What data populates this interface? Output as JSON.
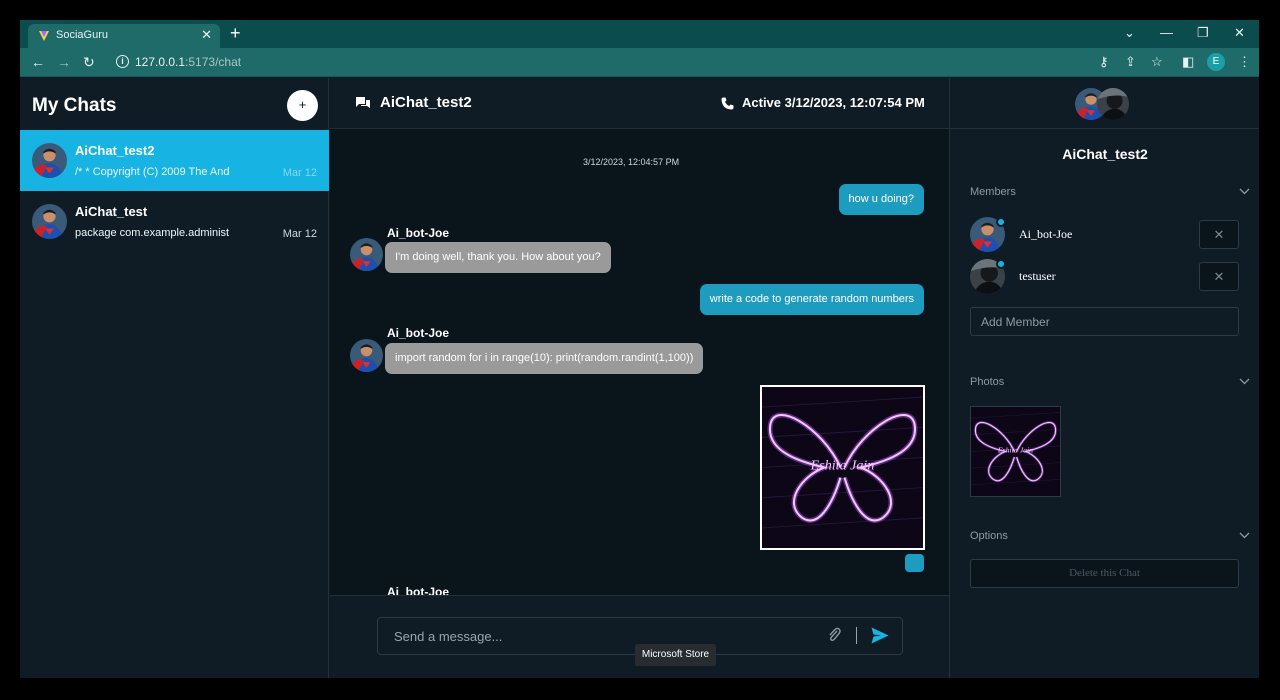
{
  "browser": {
    "tab_title": "SociaGuru",
    "tab_close": "✕",
    "new_tab": "+",
    "url_host": "127.0.0.1",
    "url_path": ":5173/chat",
    "profile_initial": "E",
    "controls": {
      "dropdown": "⌄",
      "minimize": "—",
      "restore": "❐",
      "close": "✕"
    },
    "nav": {
      "back": "←",
      "forward": "→",
      "reload": "↻"
    },
    "toolbar_icons": {
      "key": "⚷",
      "share": "⇪",
      "star": "☆",
      "sidepanel": "◧",
      "menu": "⋮"
    }
  },
  "sidebar": {
    "title": "My Chats",
    "add_label": "+",
    "chats": [
      {
        "name": "AiChat_test2",
        "preview": "/* * Copyright (C) 2009 The And",
        "date": "Mar 12",
        "active": true
      },
      {
        "name": "AiChat_test",
        "preview": "package com.example.administ",
        "date": "Mar 12",
        "active": false
      }
    ]
  },
  "chat": {
    "title": "AiChat_test2",
    "status": "Active 3/12/2023, 12:07:54 PM",
    "timestamp": "3/12/2023, 12:04:57 PM",
    "messages": [
      {
        "from": "me",
        "text": "how u doing?"
      },
      {
        "from": "bot",
        "sender": "Ai_bot-Joe",
        "text": "I'm doing well, thank you. How about you?"
      },
      {
        "from": "me",
        "text": "write a code to generate random numbers"
      },
      {
        "from": "bot",
        "sender": "Ai_bot-Joe",
        "text": "import random for i in range(10): print(random.randint(1,100))"
      },
      {
        "from": "me",
        "type": "image",
        "image_text": "Eshita Jain"
      },
      {
        "from": "bot",
        "sender": "Ai_bot-Joe"
      }
    ],
    "input_placeholder": "Send a message...",
    "tooltip": "Microsoft Store"
  },
  "details": {
    "title": "AiChat_test2",
    "members_label": "Members",
    "members": [
      {
        "name": "Ai_bot-Joe",
        "remove": "✕"
      },
      {
        "name": "testuser",
        "remove": "✕"
      }
    ],
    "add_member_placeholder": "Add Member",
    "photos_label": "Photos",
    "options_label": "Options",
    "delete_label": "Delete this Chat"
  },
  "colors": {
    "accent": "#16b3e3",
    "outgoing_bubble": "#1e9cbf",
    "incoming_bubble": "#9a9a9a",
    "background": "#0f1c26",
    "chrome": "#1f6b69"
  }
}
